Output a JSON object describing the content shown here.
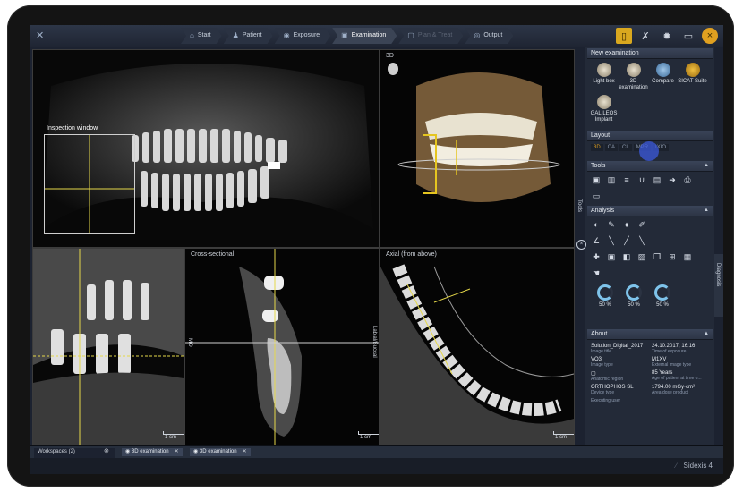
{
  "steps": [
    {
      "label": "Start",
      "icon": "home-icon"
    },
    {
      "label": "Patient",
      "icon": "person-icon"
    },
    {
      "label": "Exposure",
      "icon": "tooth-icon"
    },
    {
      "label": "Examination",
      "icon": "monitor-icon"
    },
    {
      "label": "Plan & Treat",
      "icon": "plan-icon"
    },
    {
      "label": "Output",
      "icon": "output-icon"
    }
  ],
  "viewports": {
    "panoramic": {
      "title": "Inspection window"
    },
    "volume": {
      "title": "3D"
    },
    "lower_left": {
      "scale": "1 cm"
    },
    "cross": {
      "title": "Cross-sectional",
      "left_orient": "MO",
      "right_orient": "Labial/Buccal",
      "scale": "1 cm"
    },
    "axial": {
      "title": "Axial (from above)",
      "scale": "1 cm"
    }
  },
  "panel": {
    "new_exam": {
      "title": "New examination",
      "items": [
        {
          "label": "Light box"
        },
        {
          "label": "3D examination"
        },
        {
          "label": "Compare"
        },
        {
          "label": "SICAT Suite"
        },
        {
          "label": "GALILEOS Implant"
        }
      ]
    },
    "layout": {
      "title": "Layout",
      "options": [
        "3D",
        "CA",
        "CL",
        "MPR",
        "IXIO"
      ]
    },
    "tools": {
      "title": "Tools",
      "side_tab": "Tools"
    },
    "analysis": {
      "title": "Analysis",
      "gauges": [
        "50 %",
        "50 %",
        "50 %"
      ]
    },
    "about": {
      "title": "About",
      "rows": [
        [
          {
            "value": "Solution_Digital_2017",
            "label": "Image title"
          },
          {
            "value": "24.10.2017, 16:16",
            "label": "Time of exposure"
          }
        ],
        [
          {
            "value": "VO3",
            "label": "Image type"
          },
          {
            "value": "M1XV",
            "label": "External image type"
          }
        ],
        [
          {
            "value": "",
            "label": "Anatomic region"
          },
          {
            "value": "85 Years",
            "label": "Age of patient at time o..."
          }
        ],
        [
          {
            "value": "ORTHOPHOS SL",
            "label": "Device type"
          },
          {
            "value": "1794.00 mGy·cm²",
            "label": "Area dose product"
          }
        ],
        [
          {
            "value": "",
            "label": "Executing user"
          },
          {
            "value": "",
            "label": ""
          }
        ]
      ]
    }
  },
  "diagnosis_tab": "Diagnosis",
  "bottom": {
    "workspaces": "Workspaces (2)",
    "tabs": [
      "3D examination",
      "3D examination"
    ]
  },
  "brand": "Sidexis 4"
}
